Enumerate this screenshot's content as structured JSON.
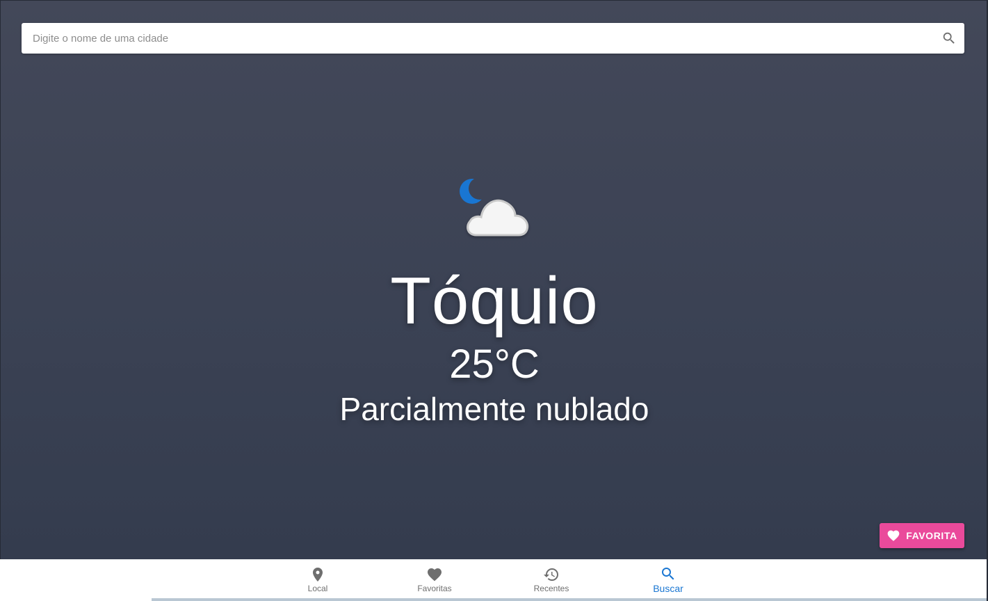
{
  "search": {
    "placeholder": "Digite o nome de uma cidade",
    "value": "",
    "icon": "search-icon"
  },
  "weather": {
    "icon": "moon-cloud-icon",
    "city": "Tóquio",
    "temperature": "25°C",
    "condition": "Parcialmente nublado"
  },
  "favorite_button": {
    "label": "FAVORITA",
    "icon": "heart-icon",
    "color": "#ea4a9b"
  },
  "bottom_nav": {
    "active_color": "#1976d2",
    "items": [
      {
        "label": "Local",
        "icon": "location-pin-icon",
        "active": false
      },
      {
        "label": "Favoritas",
        "icon": "heart-icon",
        "active": false
      },
      {
        "label": "Recentes",
        "icon": "history-icon",
        "active": false
      },
      {
        "label": "Buscar",
        "icon": "search-icon",
        "active": true
      }
    ]
  },
  "colors": {
    "background_top": "#434859",
    "background_bottom": "#343c4e",
    "moon": "#1976d2",
    "cloud": "#f5f5f5"
  }
}
